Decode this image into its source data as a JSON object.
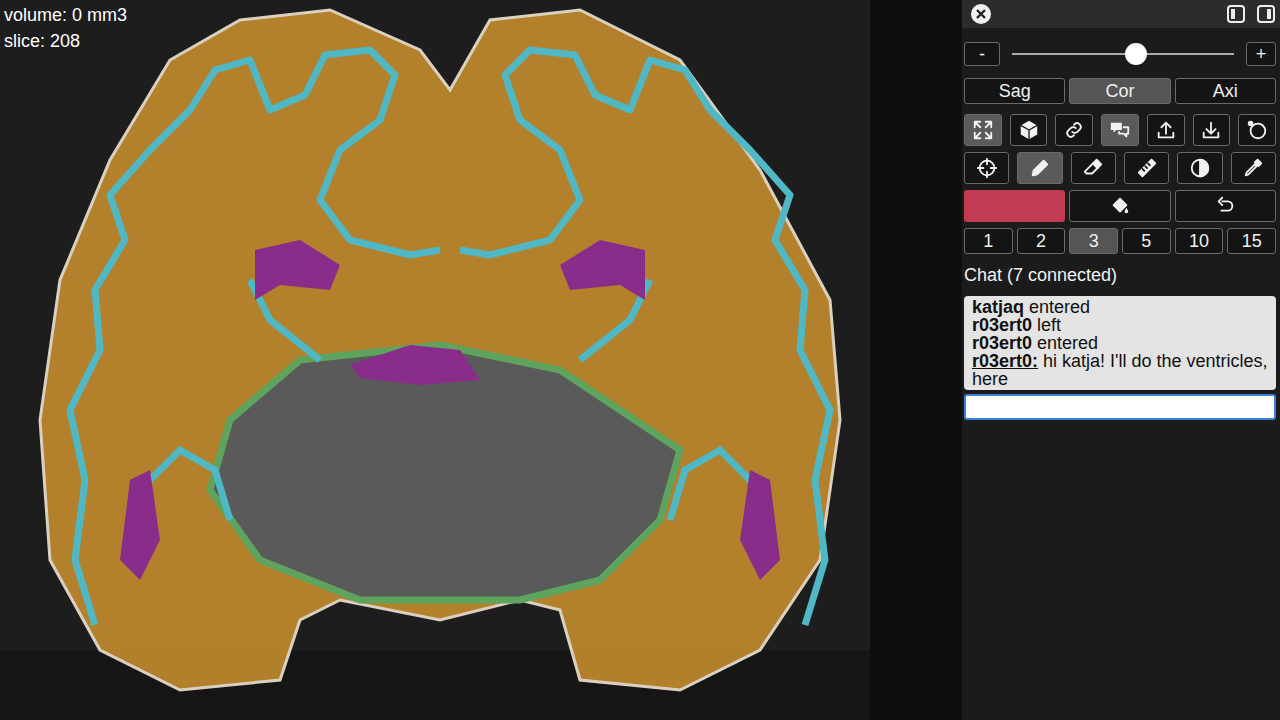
{
  "viewer": {
    "volume": "volume: 0 mm3",
    "slice": "slice: 208"
  },
  "zoom": {
    "minus": "-",
    "plus": "+",
    "level": 0.56
  },
  "views": [
    {
      "label": "Sag",
      "selected": false
    },
    {
      "label": "Cor",
      "selected": true
    },
    {
      "label": "Axi",
      "selected": false
    }
  ],
  "tools": [
    {
      "kind": "fullscreen",
      "selected": true
    },
    {
      "kind": "cube",
      "selected": false
    },
    {
      "kind": "link",
      "selected": false
    },
    {
      "kind": "chat",
      "selected": true
    },
    {
      "kind": "upload",
      "selected": false
    },
    {
      "kind": "download",
      "selected": false
    },
    {
      "kind": "rotate",
      "selected": false
    }
  ],
  "paint_tools": [
    {
      "kind": "crosshair",
      "selected": false
    },
    {
      "kind": "pencil",
      "selected": true
    },
    {
      "kind": "eraser",
      "selected": false
    },
    {
      "kind": "ruler",
      "selected": false
    },
    {
      "kind": "contrast",
      "selected": false
    },
    {
      "kind": "eyedropper",
      "selected": false
    }
  ],
  "actions": [
    {
      "kind": "color",
      "color": "#c13b52"
    },
    {
      "kind": "fill"
    },
    {
      "kind": "undo"
    }
  ],
  "sizes": [
    {
      "label": "1",
      "selected": false
    },
    {
      "label": "2",
      "selected": false
    },
    {
      "label": "3",
      "selected": true
    },
    {
      "label": "5",
      "selected": false
    },
    {
      "label": "10",
      "selected": false
    },
    {
      "label": "15",
      "selected": false
    }
  ],
  "chat": {
    "title": "Chat (7 connected)",
    "messages": [
      {
        "kind": "event",
        "user": "katjaq",
        "text": "entered"
      },
      {
        "kind": "event",
        "user": "r03ert0",
        "text": "left"
      },
      {
        "kind": "event",
        "user": "r03ert0",
        "text": "entered"
      },
      {
        "kind": "message",
        "user": "r03ert0:",
        "text": "hi katja! I'll do the ventricles, here"
      }
    ],
    "input": ""
  }
}
